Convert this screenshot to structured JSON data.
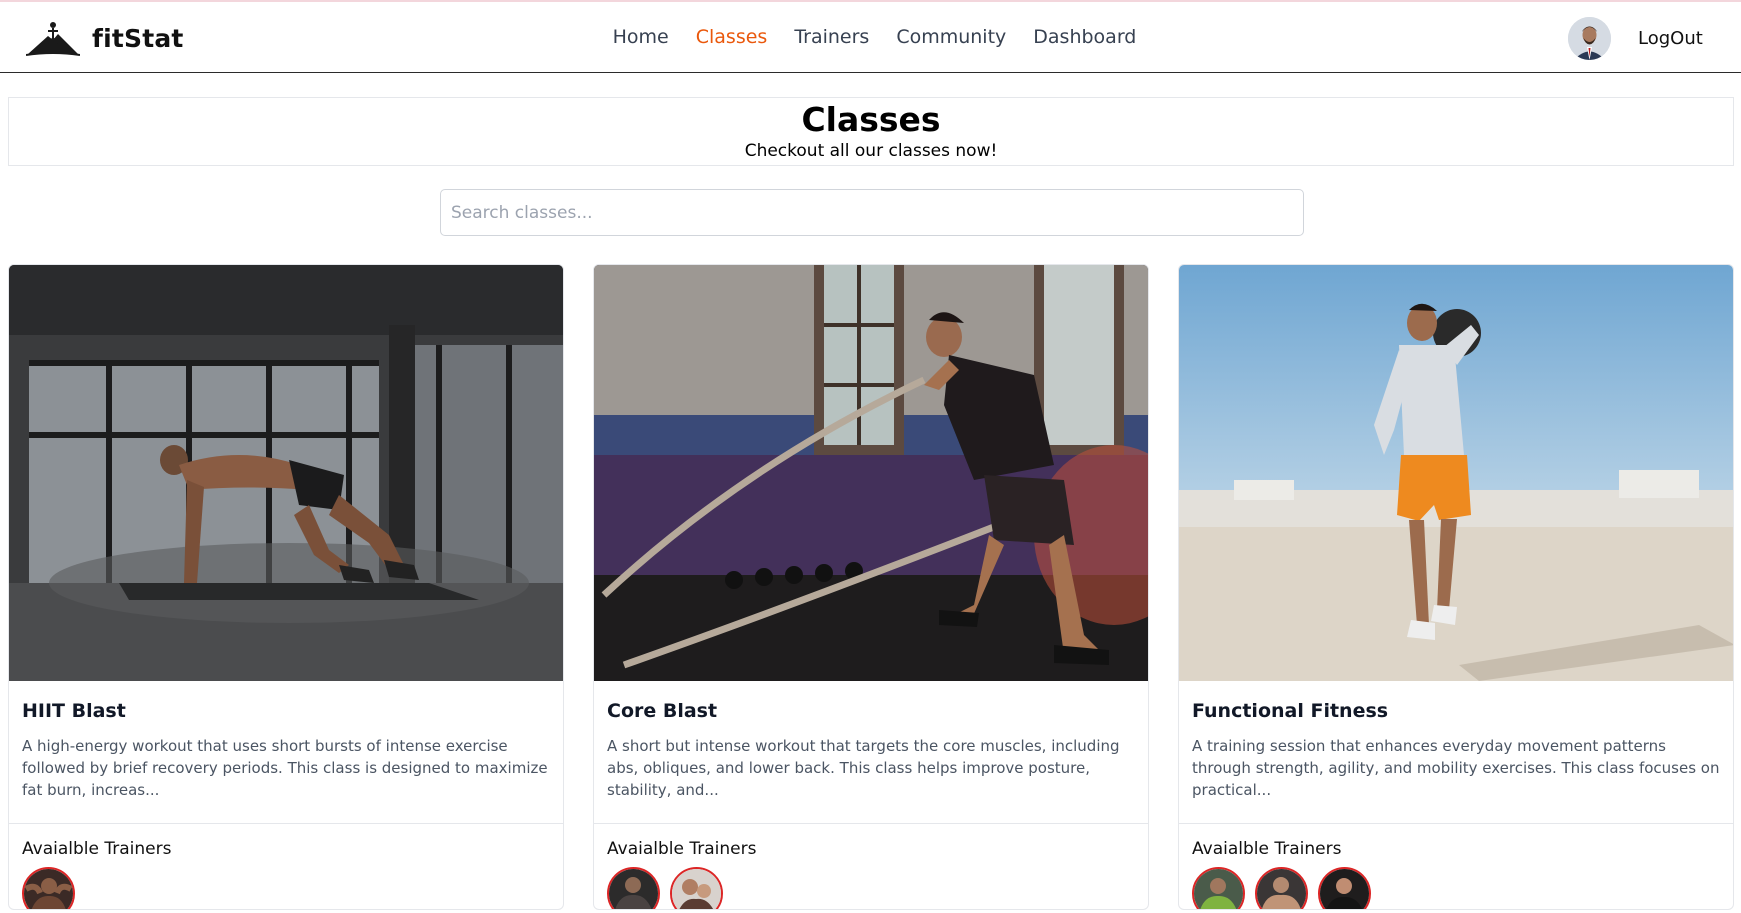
{
  "brand": {
    "name": "fitStat"
  },
  "nav": {
    "links": [
      {
        "label": "Home",
        "active": false
      },
      {
        "label": "Classes",
        "active": true
      },
      {
        "label": "Trainers",
        "active": false
      },
      {
        "label": "Community",
        "active": false
      },
      {
        "label": "Dashboard",
        "active": false
      }
    ],
    "logout_label": "LogOut",
    "active_color": "#ea580c"
  },
  "hero": {
    "title": "Classes",
    "subtitle": "Checkout all our classes now!"
  },
  "search": {
    "placeholder": "Search classes..."
  },
  "classes": [
    {
      "title": "HIIT Blast",
      "description": "A high-energy workout that uses short bursts of intense exercise followed by brief recovery periods. This class is designed to maximize fat burn, increas...",
      "trainers_label": "Avaialble Trainers",
      "trainer_count": 1
    },
    {
      "title": "Core Blast",
      "description": "A short but intense workout that targets the core muscles, including abs, obliques, and lower back. This class helps improve posture, stability, and...",
      "trainers_label": "Avaialble Trainers",
      "trainer_count": 2
    },
    {
      "title": "Functional Fitness",
      "description": "A training session that enhances everyday movement patterns through strength, agility, and mobility exercises. This class focuses on practical...",
      "trainers_label": "Avaialble Trainers",
      "trainer_count": 3
    }
  ]
}
